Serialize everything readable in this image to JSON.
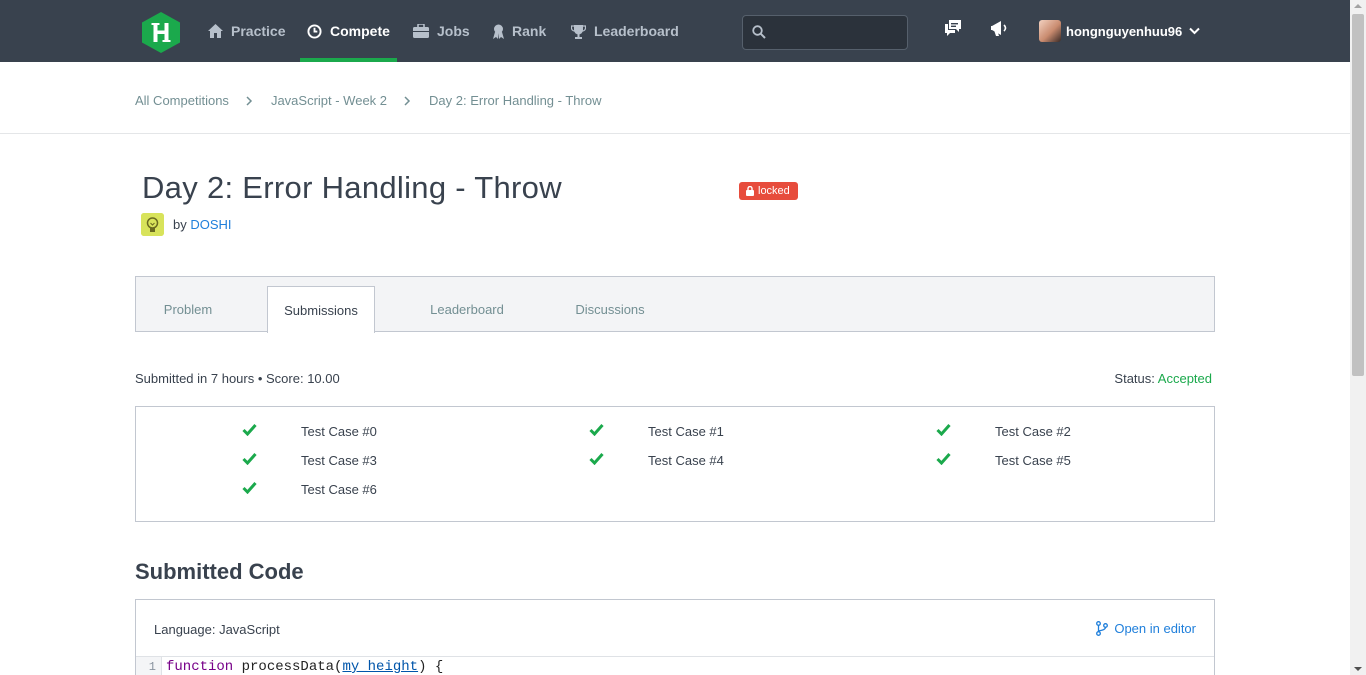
{
  "nav": {
    "items": [
      {
        "label": "Practice",
        "icon": "home-icon"
      },
      {
        "label": "Compete",
        "icon": "clock-icon",
        "active": true
      },
      {
        "label": "Jobs",
        "icon": "briefcase-icon"
      },
      {
        "label": "Rank",
        "icon": "ribbon-icon"
      },
      {
        "label": "Leaderboard",
        "icon": "trophy-icon"
      }
    ],
    "search_placeholder": "",
    "username": "hongnguyenhuu96"
  },
  "breadcrumb": [
    "All Competitions",
    "JavaScript - Week 2",
    "Day 2: Error Handling - Throw"
  ],
  "challenge": {
    "title": "Day 2: Error Handling - Throw",
    "badge": "locked",
    "author_prefix": "by",
    "author": "DOSHI"
  },
  "tabs": [
    {
      "label": "Problem"
    },
    {
      "label": "Submissions",
      "active": true
    },
    {
      "label": "Leaderboard"
    },
    {
      "label": "Discussions"
    }
  ],
  "submission": {
    "info": "Submitted in 7 hours • Score: 10.00",
    "status_label": "Status:",
    "status_value": "Accepted",
    "test_cases": [
      "Test Case #0",
      "Test Case #1",
      "Test Case #2",
      "Test Case #3",
      "Test Case #4",
      "Test Case #5",
      "Test Case #6"
    ]
  },
  "code": {
    "heading": "Submitted Code",
    "language": "Language: JavaScript",
    "open_in_editor": "Open in editor",
    "line_number": "1",
    "line_keyword": "function",
    "line_fn": " processData(",
    "line_param": "my_height",
    "line_end": ") {"
  },
  "colors": {
    "nav_bg": "#39424e",
    "accent_green": "#1ba94c",
    "link_blue": "#1f7fdb",
    "locked_red": "#e74c3c"
  }
}
